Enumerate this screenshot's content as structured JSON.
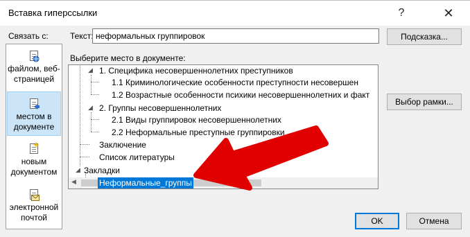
{
  "window": {
    "title": "Вставка гиперссылки",
    "help_glyph": "?",
    "close_glyph": "✕"
  },
  "link_to": {
    "label": "Связать с:",
    "items": [
      {
        "label_1": "файлом, веб-",
        "label_2": "страницей",
        "icon": "web-page-icon"
      },
      {
        "label_1": "местом в",
        "label_2": "документе",
        "icon": "place-in-document-icon",
        "selected": true
      },
      {
        "label_1": "новым",
        "label_2": "документом",
        "icon": "new-document-icon"
      },
      {
        "label_1": "электронной",
        "label_2": "почтой",
        "icon": "email-icon"
      }
    ]
  },
  "text_field": {
    "label": "Текст:",
    "value": "неформальных группировок"
  },
  "buttons": {
    "hint": "Подсказка...",
    "frame": "Выбор рамки...",
    "ok": "OK",
    "cancel": "Отмена"
  },
  "place": {
    "label": "Выберите место в документе:",
    "tree": [
      {
        "text": "1. Специфика несовершеннолетних преступников"
      },
      {
        "text": "1.1 Криминологические особенности преступности несовершен"
      },
      {
        "text": "1.2 Возрастные особенности психики несовершеннолетних и факт"
      },
      {
        "text": "2. Группы несовершеннолетних"
      },
      {
        "text": "2.1 Виды группировок несовершеннолетних"
      },
      {
        "text": "2.2 Неформальные преступные группировки"
      },
      {
        "text": "Заключение"
      },
      {
        "text": "Список литературы"
      },
      {
        "text": "Закладки"
      },
      {
        "text": "Неформальные_группы",
        "selected": true
      }
    ]
  },
  "colors": {
    "selection": "#0078d7",
    "annotation_arrow": "#e00000"
  }
}
